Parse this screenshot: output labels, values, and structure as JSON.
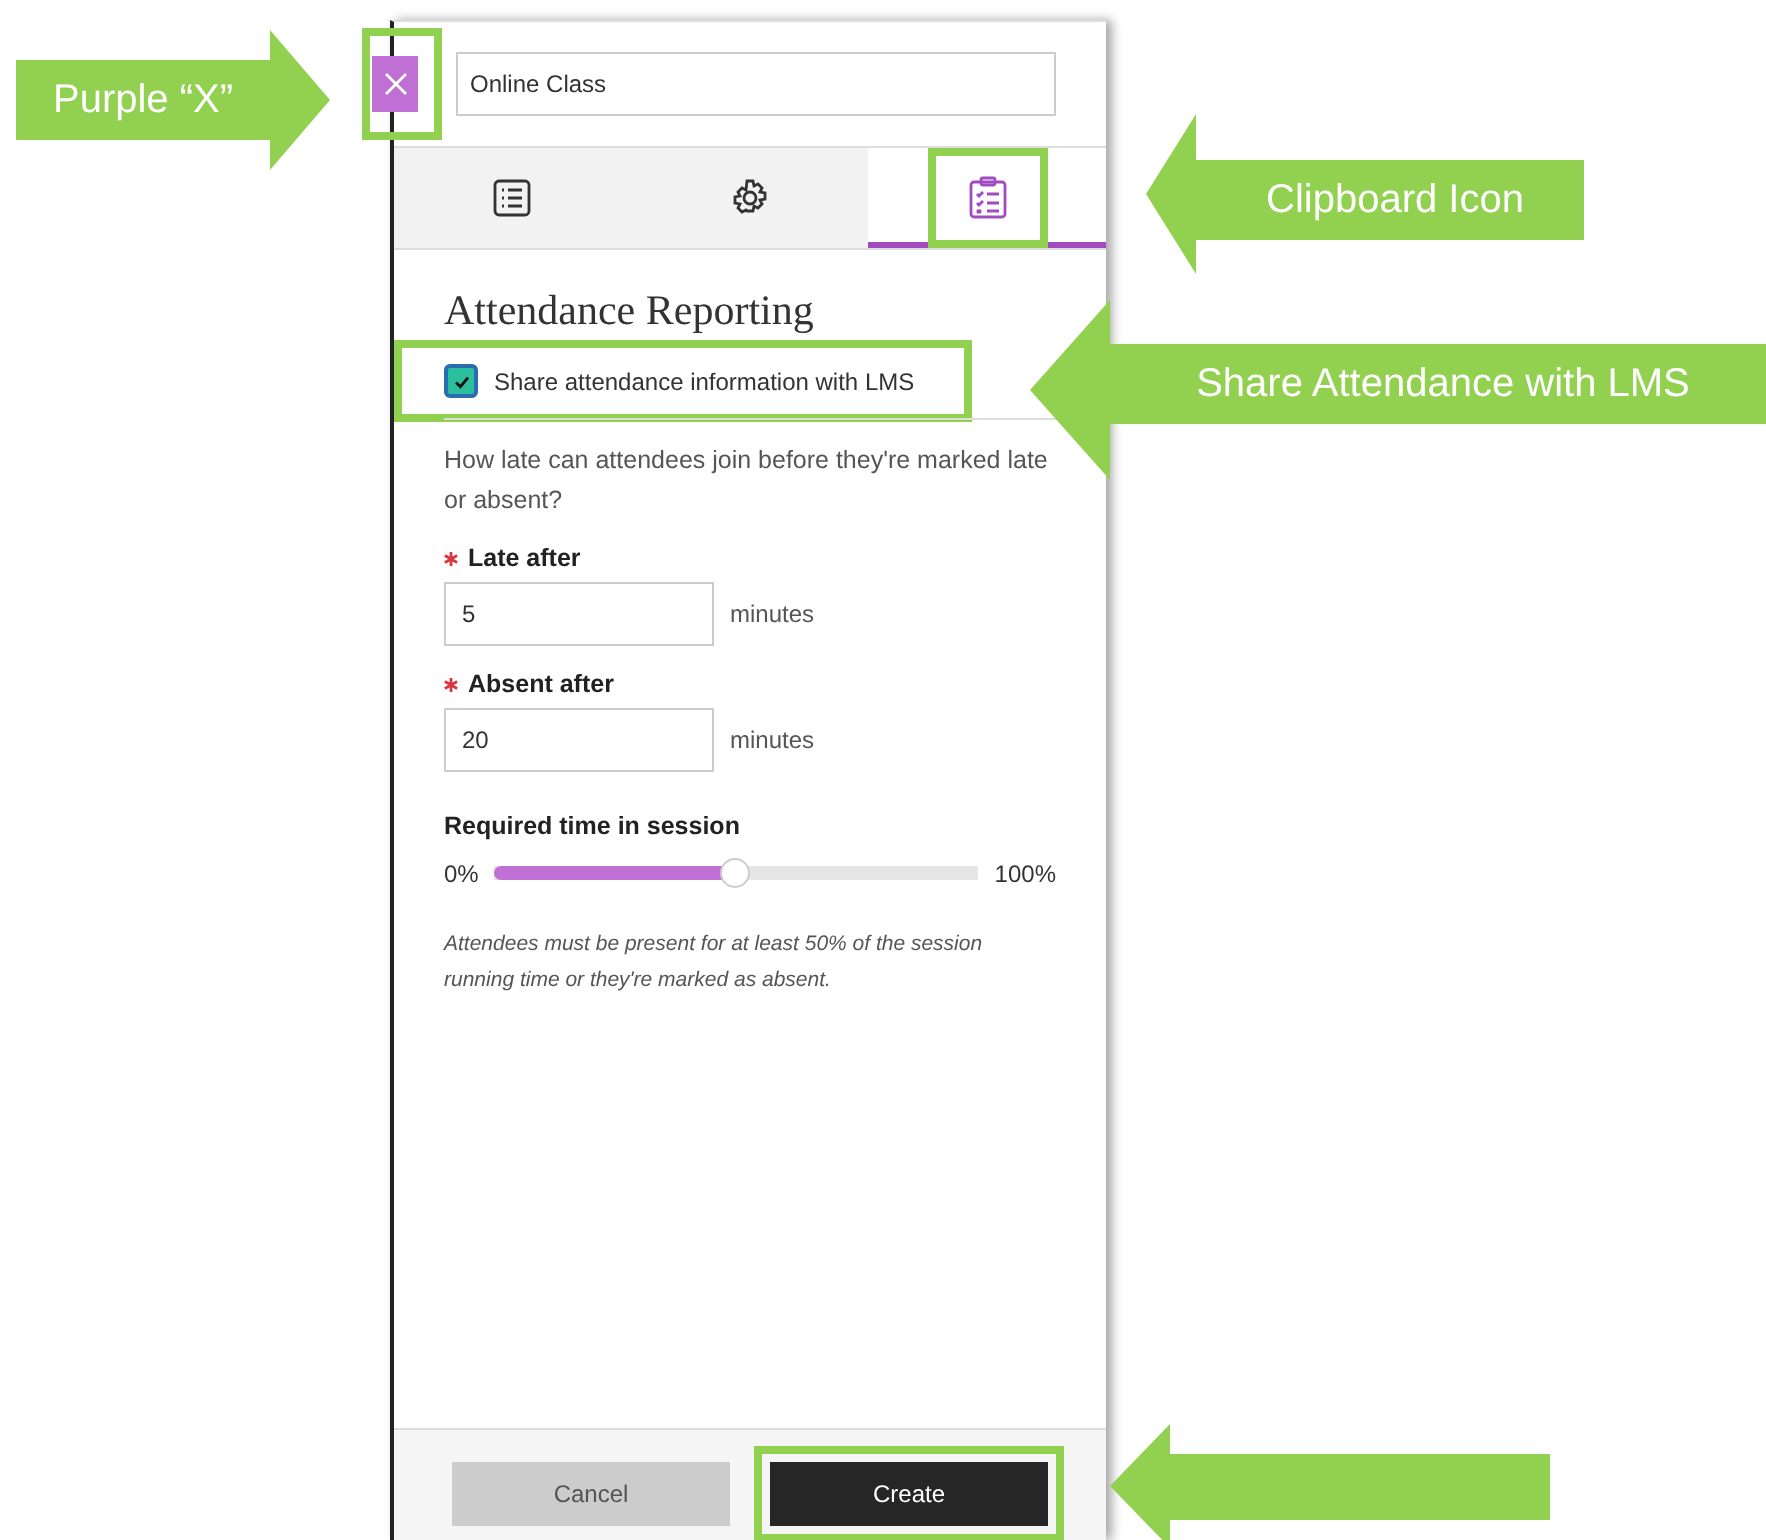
{
  "dialog": {
    "close_button": {
      "highlighted": true
    },
    "title_field": {
      "value": "Online Class"
    },
    "tabs": [
      {
        "kind": "list",
        "selected": false,
        "highlighted": false
      },
      {
        "kind": "settings",
        "selected": false,
        "highlighted": false
      },
      {
        "kind": "clipboard",
        "selected": true,
        "highlighted": true
      }
    ],
    "heading": "Attendance Reporting",
    "share_checkbox": {
      "label": "Share attendance information with LMS",
      "checked": true,
      "highlighted": true
    },
    "intro": "How late can attendees join before they're marked late or absent?",
    "fields": [
      {
        "label": "Late after",
        "required": true,
        "value": "5",
        "unit": "minutes"
      },
      {
        "label": "Absent after",
        "required": true,
        "value": "20",
        "unit": "minutes"
      }
    ],
    "slider": {
      "label": "Required time in session",
      "min_label": "0%",
      "max_label": "100%",
      "level": 0.5
    },
    "note": "Attendees must be present for at least 50% of the session running time or they're marked as absent.",
    "buttons": [
      {
        "label": "Cancel",
        "kind": "secondary",
        "highlighted": false
      },
      {
        "label": "Create",
        "kind": "primary",
        "highlighted": true
      }
    ]
  },
  "callouts": [
    {
      "text": "Purple “X”",
      "kind": "right-arrow"
    },
    {
      "text": "Clipboard Icon",
      "kind": "left-arrow"
    },
    {
      "text": "Share Attendance with LMS",
      "kind": "left-arrow"
    },
    {
      "kind": "left-arrow"
    }
  ]
}
